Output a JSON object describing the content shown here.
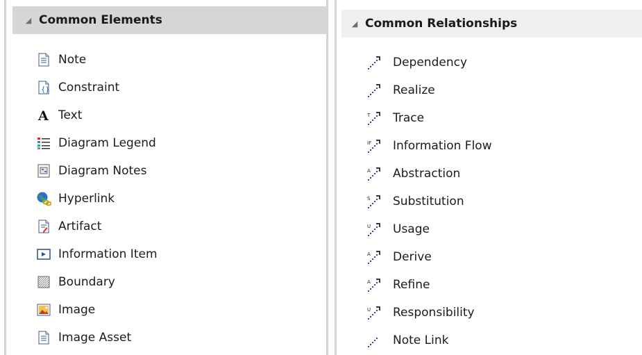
{
  "left_panel": {
    "header": "Common Elements",
    "items": [
      {
        "label": "Note",
        "icon": "note-icon"
      },
      {
        "label": "Constraint",
        "icon": "constraint-icon"
      },
      {
        "label": "Text",
        "icon": "text-icon"
      },
      {
        "label": "Diagram Legend",
        "icon": "diagram-legend-icon"
      },
      {
        "label": "Diagram Notes",
        "icon": "diagram-notes-icon"
      },
      {
        "label": "Hyperlink",
        "icon": "hyperlink-icon"
      },
      {
        "label": "Artifact",
        "icon": "artifact-icon"
      },
      {
        "label": "Information Item",
        "icon": "information-item-icon"
      },
      {
        "label": "Boundary",
        "icon": "boundary-icon"
      },
      {
        "label": "Image",
        "icon": "image-icon"
      },
      {
        "label": "Image Asset",
        "icon": "image-asset-icon"
      }
    ]
  },
  "right_panel": {
    "header": "Common Relationships",
    "items": [
      {
        "label": "Dependency",
        "icon": "dependency-icon",
        "icon_letter": ""
      },
      {
        "label": "Realize",
        "icon": "realize-icon",
        "icon_letter": ""
      },
      {
        "label": "Trace",
        "icon": "trace-icon",
        "icon_letter": "T"
      },
      {
        "label": "Information Flow",
        "icon": "information-flow-icon",
        "icon_letter": "IF"
      },
      {
        "label": "Abstraction",
        "icon": "abstraction-icon",
        "icon_letter": "A"
      },
      {
        "label": "Substitution",
        "icon": "substitution-icon",
        "icon_letter": "S"
      },
      {
        "label": "Usage",
        "icon": "usage-icon",
        "icon_letter": "U"
      },
      {
        "label": "Derive",
        "icon": "derive-icon",
        "icon_letter": "A"
      },
      {
        "label": "Refine",
        "icon": "refine-icon",
        "icon_letter": "A"
      },
      {
        "label": "Responsibility",
        "icon": "responsibility-icon",
        "icon_letter": "U"
      },
      {
        "label": "Note Link",
        "icon": "note-link-icon",
        "icon_letter": ""
      }
    ]
  },
  "colors": {
    "left_header_bg": "#d6d6d6",
    "right_header_bg": "#efefef",
    "divider": "#d4d4d4",
    "connector_dots": "#3a3a8c"
  }
}
